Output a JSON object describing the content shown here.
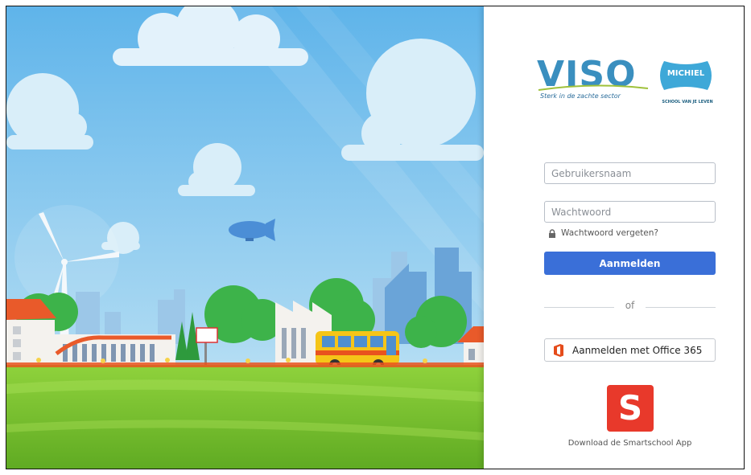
{
  "brand": {
    "viso_name": "VISO",
    "viso_tagline": "Sterk in de zachte sector",
    "michiel_name": "MICHIEL",
    "michiel_tagline": "SCHOOL VAN JE LEVEN",
    "viso_color": "#3a8fbf",
    "michiel_color": "#3ea8d8"
  },
  "login": {
    "username_placeholder": "Gebruikersnaam",
    "password_placeholder": "Wachtwoord",
    "forgot_password": "Wachtwoord vergeten?",
    "submit_label": "Aanmelden",
    "separator": "of",
    "office365_label": "Aanmelden met Office 365",
    "submit_color": "#3a6fd8"
  },
  "app": {
    "icon_letter": "S",
    "caption": "Download de Smartschool App",
    "icon_color": "#e8392b"
  },
  "icons": {
    "lock": "lock-icon",
    "office": "office365-icon",
    "smartschool": "smartschool-app-icon"
  }
}
